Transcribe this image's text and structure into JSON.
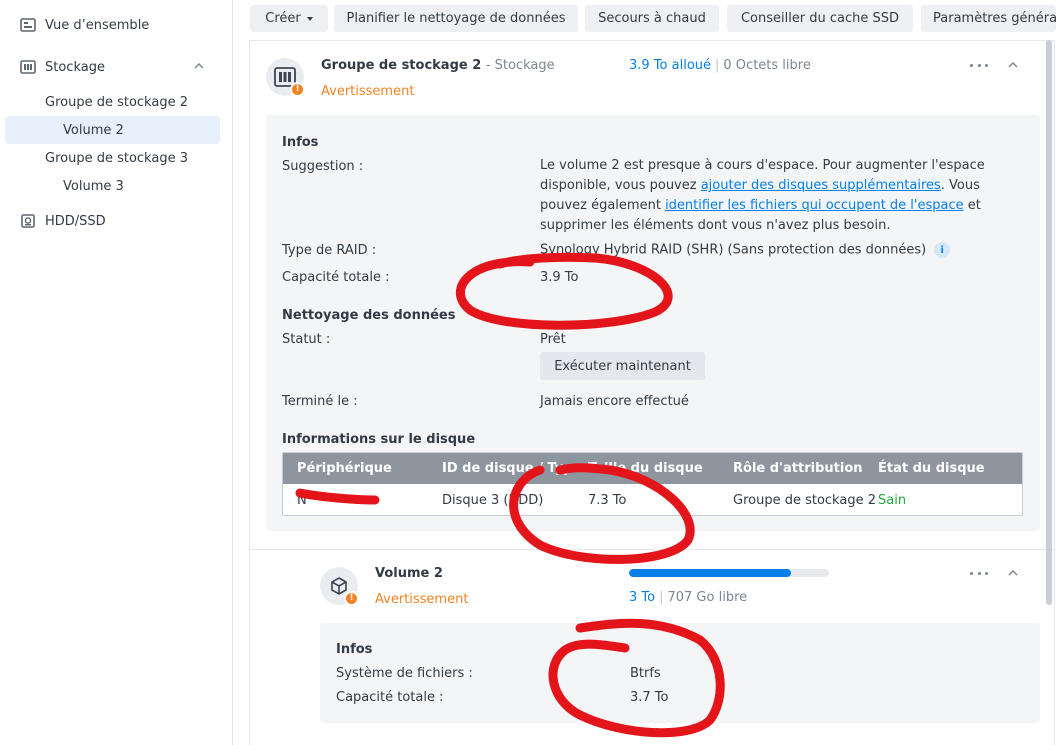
{
  "sidebar": {
    "overview": "Vue d’ensemble",
    "storage": "Stockage",
    "pool2": "Groupe de stockage 2",
    "volume2": "Volume 2",
    "pool3": "Groupe de stockage 3",
    "volume3": "Volume 3",
    "hddssd": "HDD/SSD"
  },
  "toolbar": {
    "create": "Créer",
    "scrub": "Planifier le nettoyage de données",
    "hotspare": "Secours à chaud",
    "ssdcache": "Conseiller du cache SSD",
    "settings": "Paramètres générau"
  },
  "pool": {
    "title": "Groupe de stockage 2",
    "subtitle": "- Stockage",
    "status": "Avertissement",
    "allocated": "3.9 To alloué",
    "separator": "|",
    "free": "0 Octets libre",
    "info_heading": "Infos",
    "suggestion_label": "Suggestion :",
    "suggestion_part1": "Le volume 2 est presque à cours d'espace. Pour augmenter l'espace disponible, vous pouvez ",
    "suggestion_link1": "ajouter des disques supplémentaires",
    "suggestion_part2": ". Vous pouvez également ",
    "suggestion_link2": "identifier les fichiers qui occupent de l'espace",
    "suggestion_part3": " et supprimer les éléments dont vous n'avez plus besoin.",
    "raid_label": "Type de RAID :",
    "raid_value": "Synology Hybrid RAID (SHR) (Sans protection des données)",
    "info_icon": "i",
    "capacity_label": "Capacité totale :",
    "capacity_value": "3.9 To",
    "scrub_heading": "Nettoyage des données",
    "status_label": "Statut :",
    "status_value": "Prêt",
    "run_now": "Exécuter maintenant",
    "finished_label": "Terminé le :",
    "finished_value": "Jamais encore effectué",
    "disk_heading": "Informations sur le disque"
  },
  "disk_table": {
    "headers": [
      "Périphérique",
      "ID de disque / Type",
      "Taille du disque",
      "Rôle d'attribution",
      "État du disque"
    ],
    "rows": [
      {
        "device": "N",
        "disk": "Disque 3 (HDD)",
        "size": "7.3 To",
        "role": "Groupe de stockage 2",
        "state": "Sain"
      }
    ]
  },
  "volume": {
    "title": "Volume 2",
    "status": "Avertissement",
    "used_fraction": 0.81,
    "used": "3 To",
    "separator": "|",
    "free": "707 Go libre",
    "info_heading": "Infos",
    "fs_label": "Système de fichiers :",
    "fs_value": "Btrfs",
    "capacity_label": "Capacité totale :",
    "capacity_value": "3.7 To"
  },
  "icons": {
    "warning": "!",
    "accent": "#057feb",
    "warning_color": "#f08424",
    "healthy_color": "#22a83a",
    "annotation_color": "#e3151a"
  }
}
